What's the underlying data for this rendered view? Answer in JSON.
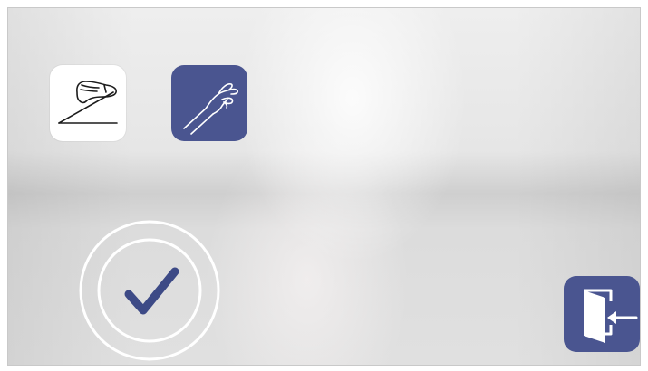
{
  "screen": {
    "background_color": "#e6e6e6",
    "accent_color": "#4a5590"
  },
  "mode_buttons": [
    {
      "icon": "foot-pedal-icon",
      "background": "#ffffff",
      "selected": false
    },
    {
      "icon": "hand-icon",
      "background": "#4a5590",
      "selected": true
    }
  ],
  "confirm_button": {
    "icon": "checkmark-icon",
    "ring_color": "#ffffff",
    "check_color": "#3d4a86"
  },
  "exit_button": {
    "icon": "exit-door-icon",
    "background": "#4a5590"
  }
}
